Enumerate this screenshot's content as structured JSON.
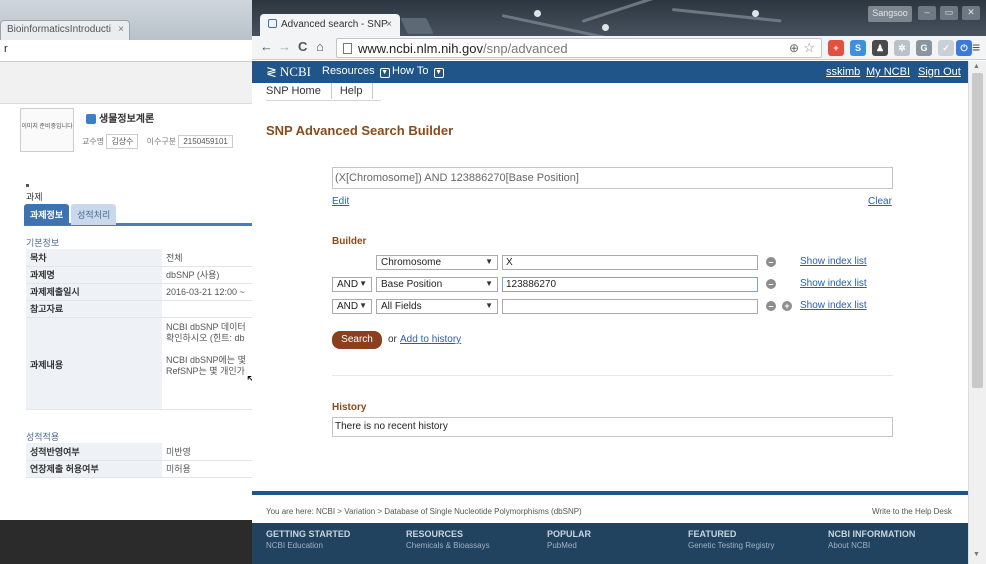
{
  "background_window": {
    "tab_title": "BioinformaticsIntroducti",
    "tab_close": "×",
    "url_fragment": "r",
    "course_logo_text": "이미지 준비중입니다",
    "course_name": "생물정보계론",
    "professor_label": "교수명",
    "professor_name": "김상수",
    "course_type_label": "이수구분",
    "course_code": "2150459101",
    "assignment_title": "과제",
    "tabs": [
      "과제정보",
      "성적처리"
    ],
    "basic_info_label": "기본정보",
    "rows": [
      {
        "label": "목차",
        "value": "전체"
      },
      {
        "label": "과제명",
        "value": "dbSNP (사용)"
      },
      {
        "label": "과제제출일시",
        "value": "2016-03-21 12:00 ~"
      },
      {
        "label": "참고자료",
        "value": ""
      }
    ],
    "content_label": "과제내용",
    "content_lines": [
      "NCBI dbSNP 데이터",
      "확인하시오 (힌트: db",
      "",
      "NCBI dbSNP에는 몇",
      "RefSNP는 몇 개인가"
    ],
    "grade_section_label": "성적적용",
    "grade_rows": [
      {
        "label": "성적반영여부",
        "value": "미반영"
      },
      {
        "label": "연장제출 허용여부",
        "value": "미허용"
      }
    ]
  },
  "browser": {
    "tab_title": "Advanced search - SNP",
    "tab_close": "×",
    "profile_label": "Sangsoo",
    "window_buttons": [
      "–",
      "▭",
      "✕"
    ],
    "url_host": "www.ncbi.nlm.nih.gov",
    "url_path": "/snp/advanced",
    "nav_back": "←",
    "nav_forward": "→",
    "nav_reload": "C",
    "nav_home": "⌂",
    "menu_glyph": "≡",
    "extensions": [
      {
        "icon": "plus-extension-icon",
        "glyph": "+",
        "color": "#e2503f"
      },
      {
        "icon": "s-extension-icon",
        "glyph": "S",
        "color": "#3d8fe0"
      },
      {
        "icon": "person-extension-icon",
        "glyph": "♟",
        "color": "#4a4a4a"
      },
      {
        "icon": "gear-extension-icon",
        "glyph": "✲",
        "color": "#b9c2ca"
      },
      {
        "icon": "g-extension-icon",
        "glyph": "G",
        "color": "#8a969f"
      },
      {
        "icon": "check-extension-icon",
        "glyph": "✓",
        "color": "#c9d0d6"
      },
      {
        "icon": "power-extension-icon",
        "glyph": "⏻",
        "color": "#3b7ad8"
      }
    ]
  },
  "ncbi": {
    "logo": "NCBI",
    "menu_resources": "Resources",
    "menu_howto": "How To",
    "user": "sskimb",
    "my_ncbi": "My NCBI",
    "sign_out": "Sign Out",
    "snp_nav": [
      "SNP Home",
      "Help"
    ]
  },
  "builder": {
    "title": "SNP Advanced Search Builder",
    "query": "(X[Chromosome]) AND 123886270[Base Position]",
    "edit_label": "Edit",
    "clear_label": "Clear",
    "builder_heading": "Builder",
    "rows": [
      {
        "operator": "",
        "field": "Chromosome",
        "value": "X",
        "show_index": "Show index list"
      },
      {
        "operator": "AND",
        "field": "Base Position",
        "value": "123886270",
        "show_index": "Show index list"
      },
      {
        "operator": "AND",
        "field": "All Fields",
        "value": "",
        "show_index": "Show index list"
      }
    ],
    "search_label": "Search",
    "or_label": "or",
    "add_history_label": "Add to history",
    "history_heading": "History",
    "history_text": "There is no recent history"
  },
  "footer": {
    "breadcrumb": "You are here: NCBI > Variation > Database of Single Nucleotide Polymorphisms (dbSNP)",
    "help_desk": "Write to the Help Desk",
    "columns": [
      {
        "title": "GETTING STARTED",
        "item": "NCBI Education"
      },
      {
        "title": "RESOURCES",
        "item": "Chemicals & Bioassays"
      },
      {
        "title": "POPULAR",
        "item": "PubMed"
      },
      {
        "title": "FEATURED",
        "item": "Genetic Testing Registry"
      },
      {
        "title": "NCBI INFORMATION",
        "item": "About NCBI"
      }
    ]
  },
  "colors": {
    "ncbi_blue": "#20558a",
    "heading_brown": "#8a4b1a",
    "search_button": "#8b3f1f",
    "link_blue": "#2a5db0",
    "footer_navy": "#21435f"
  }
}
